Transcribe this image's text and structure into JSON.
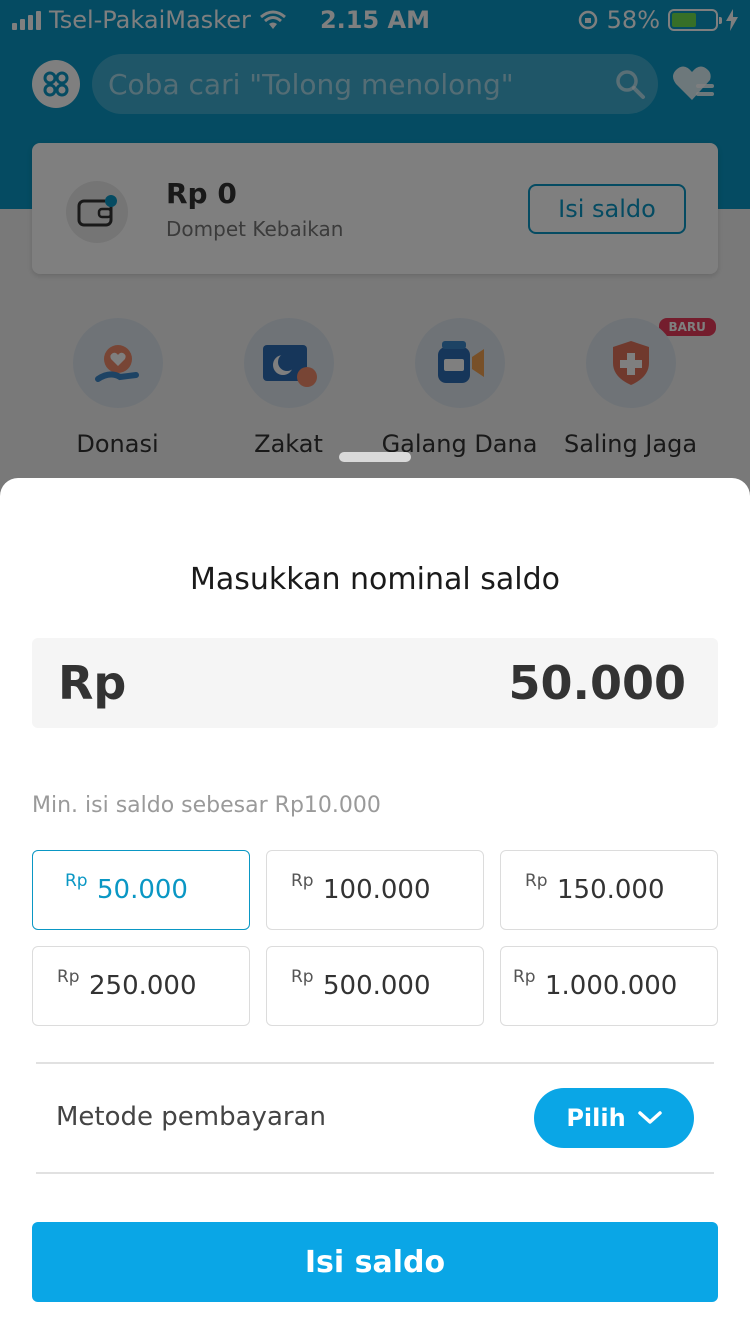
{
  "status_bar": {
    "carrier": "Tsel-PakaiMasker",
    "time": "2.15 AM",
    "battery_percent": "58%",
    "battery_level": 0.58,
    "battery_color": "#6fde4f"
  },
  "header": {
    "search_placeholder": "Coba cari \"Tolong menolong\""
  },
  "wallet": {
    "amount": "Rp 0",
    "label": "Dompet Kebaikan",
    "topup_label": "Isi saldo"
  },
  "menu": {
    "items": [
      {
        "label": "Donasi",
        "icon": "donation-heart-icon"
      },
      {
        "label": "Zakat",
        "icon": "zakat-moon-icon"
      },
      {
        "label": "Galang Dana",
        "icon": "fundraise-megaphone-icon"
      },
      {
        "label": "Saling Jaga",
        "icon": "saling-jaga-shield-icon",
        "badge": "BARU"
      }
    ]
  },
  "sheet": {
    "title": "Masukkan nominal saldo",
    "currency": "Rp",
    "amount_value": "50.000",
    "min_note": "Min. isi saldo sebesar Rp10.000",
    "presets": [
      {
        "currency": "Rp",
        "value": "50.000",
        "selected": true
      },
      {
        "currency": "Rp",
        "value": "100.000",
        "selected": false
      },
      {
        "currency": "Rp",
        "value": "150.000",
        "selected": false
      },
      {
        "currency": "Rp",
        "value": "250.000",
        "selected": false
      },
      {
        "currency": "Rp",
        "value": "500.000",
        "selected": false
      },
      {
        "currency": "Rp",
        "value": "1.000.000",
        "selected": false
      }
    ],
    "payment_label": "Metode pembayaran",
    "payment_button": "Pilih",
    "submit_label": "Isi saldo"
  },
  "colors": {
    "brand": "#0a97c4",
    "button": "#0aa6e6",
    "badge": "#e83a5a"
  }
}
